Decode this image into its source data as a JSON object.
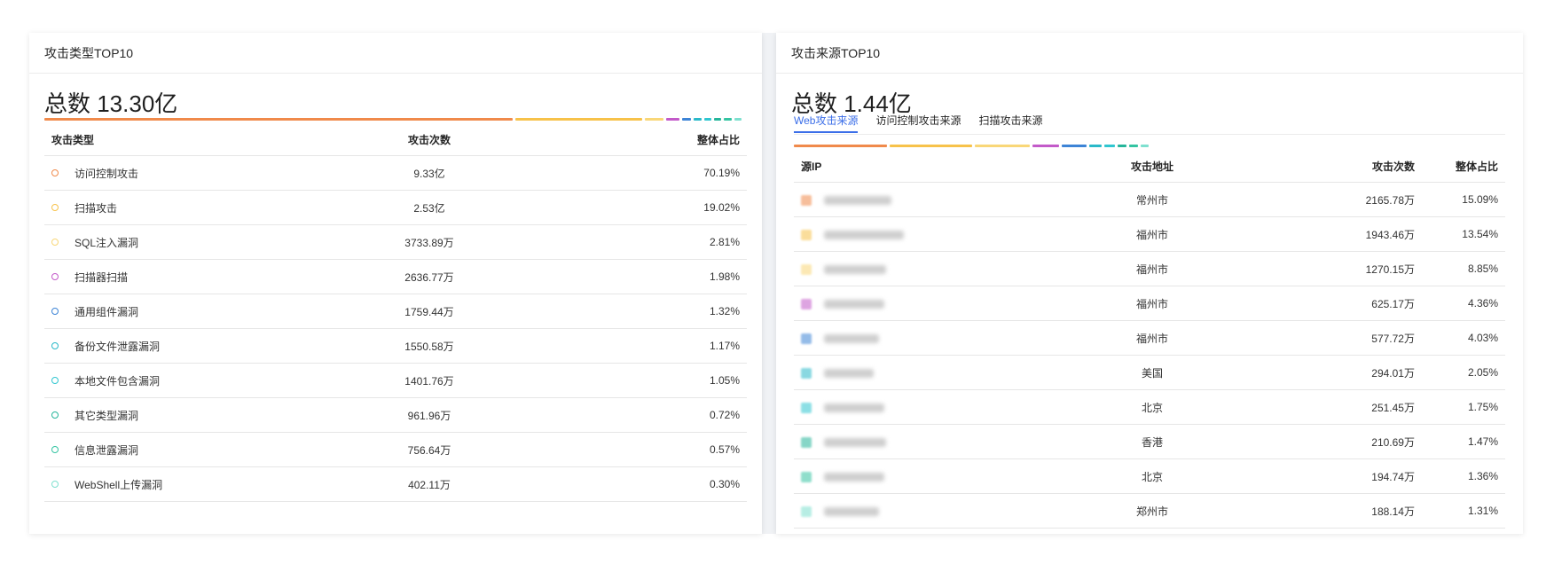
{
  "left_panel": {
    "title": "攻击类型TOP10",
    "total": "总数 13.30亿",
    "bar_colors": [
      "#f08a4b",
      "#f7c24a",
      "#f9d778",
      "#c35ac9",
      "#3d84d6",
      "#2ab9c9",
      "#30c6d0",
      "#25b59a",
      "#34c4a2",
      "#7ee0cf"
    ],
    "bar_shares": [
      70.19,
      19.02,
      2.81,
      1.98,
      1.32,
      1.17,
      1.05,
      0.72,
      0.57,
      0.3
    ],
    "columns": [
      "攻击类型",
      "攻击次数",
      "整体占比"
    ],
    "rows": [
      {
        "name": "访问控制攻击",
        "count": "9.33亿",
        "share": "70.19%",
        "color": "#f08a4b"
      },
      {
        "name": "扫描攻击",
        "count": "2.53亿",
        "share": "19.02%",
        "color": "#f7c24a"
      },
      {
        "name": "SQL注入漏洞",
        "count": "3733.89万",
        "share": "2.81%",
        "color": "#f9d778"
      },
      {
        "name": "扫描器扫描",
        "count": "2636.77万",
        "share": "1.98%",
        "color": "#c35ac9"
      },
      {
        "name": "通用组件漏洞",
        "count": "1759.44万",
        "share": "1.32%",
        "color": "#3d84d6"
      },
      {
        "name": "备份文件泄露漏洞",
        "count": "1550.58万",
        "share": "1.17%",
        "color": "#2ab9c9"
      },
      {
        "name": "本地文件包含漏洞",
        "count": "1401.76万",
        "share": "1.05%",
        "color": "#30c6d0"
      },
      {
        "name": "其它类型漏洞",
        "count": "961.96万",
        "share": "0.72%",
        "color": "#25b59a"
      },
      {
        "name": "信息泄露漏洞",
        "count": "756.64万",
        "share": "0.57%",
        "color": "#34c4a2"
      },
      {
        "name": "WebShell上传漏洞",
        "count": "402.11万",
        "share": "0.30%",
        "color": "#7ee0cf"
      }
    ]
  },
  "right_panel": {
    "title": "攻击来源TOP10",
    "total": "总数 1.44亿",
    "tabs": [
      "Web攻击来源",
      "访问控制攻击来源",
      "扫描攻击来源"
    ],
    "active_tab": "Web攻击来源",
    "bar_colors": [
      "#f08a4b",
      "#f7c24a",
      "#f9d778",
      "#c35ac9",
      "#3d84d6",
      "#2ab9c9",
      "#30c6d0",
      "#25b59a",
      "#34c4a2",
      "#7ee0cf"
    ],
    "bar_shares": [
      15.09,
      13.54,
      8.85,
      4.36,
      4.03,
      2.05,
      1.75,
      1.47,
      1.36,
      1.31
    ],
    "columns": [
      "源IP",
      "攻击地址",
      "攻击次数",
      "整体占比"
    ],
    "rows": [
      {
        "location": "常州市",
        "count": "2165.78万",
        "share": "15.09%",
        "color": "#f08a4b"
      },
      {
        "location": "福州市",
        "count": "1943.46万",
        "share": "13.54%",
        "color": "#f7c24a"
      },
      {
        "location": "福州市",
        "count": "1270.15万",
        "share": "8.85%",
        "color": "#f9d778"
      },
      {
        "location": "福州市",
        "count": "625.17万",
        "share": "4.36%",
        "color": "#c35ac9"
      },
      {
        "location": "福州市",
        "count": "577.72万",
        "share": "4.03%",
        "color": "#3d84d6"
      },
      {
        "location": "美国",
        "count": "294.01万",
        "share": "2.05%",
        "color": "#2ab9c9"
      },
      {
        "location": "北京",
        "count": "251.45万",
        "share": "1.75%",
        "color": "#30c6d0"
      },
      {
        "location": "香港",
        "count": "210.69万",
        "share": "1.47%",
        "color": "#25b59a"
      },
      {
        "location": "北京",
        "count": "194.74万",
        "share": "1.36%",
        "color": "#34c4a2"
      },
      {
        "location": "郑州市",
        "count": "188.14万",
        "share": "1.31%",
        "color": "#7ee0cf"
      }
    ]
  }
}
